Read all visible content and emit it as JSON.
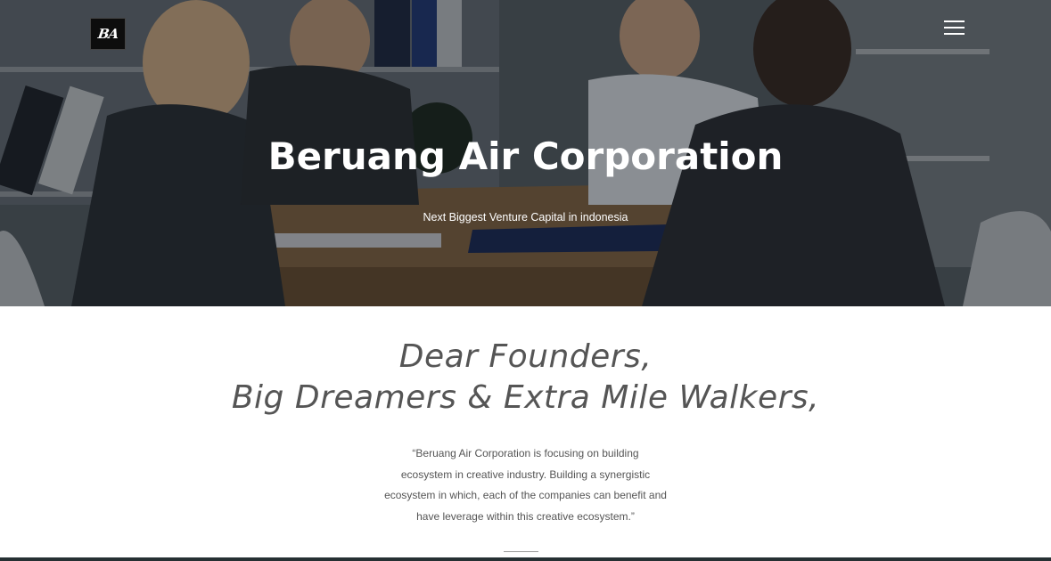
{
  "header": {
    "logo_text": "BA",
    "menu_icon": "hamburger-menu-icon"
  },
  "hero": {
    "title": "Beruang Air Corporation",
    "subtitle": "Next Biggest Venture Capital in indonesia"
  },
  "intro": {
    "headline_line1": "Dear Founders,",
    "headline_line2": "Big Dreamers & Extra Mile Walkers,",
    "quote_lines": [
      "“Beruang Air Corporation is focusing on building",
      "ecosystem in creative industry. Building a synergistic",
      "ecosystem in which, each of the companies can benefit and",
      "have leverage within this creative ecosystem.”"
    ]
  },
  "colors": {
    "hero_overlay": "#0a0e14",
    "text_muted": "#555555",
    "footer_strip": "#263033"
  }
}
